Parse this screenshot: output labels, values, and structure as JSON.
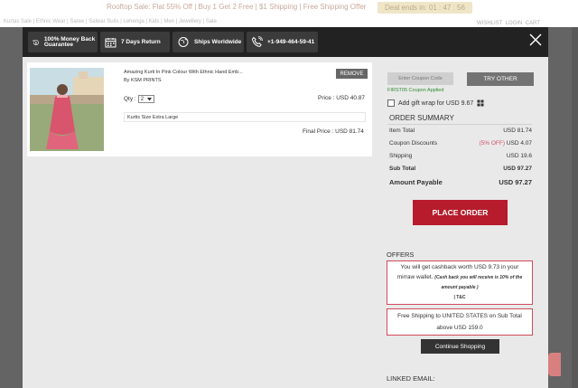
{
  "background": {
    "promo_text": "Rooftop Sale: Flat 55% Off | Buy 1 Get 2 Free | $1 Shipping | Free Shipping Offer",
    "deal_badge": "Deal ends in: 01 : 47 : 56",
    "nav_text": "Kurtas Sale | Ethnic Wear | Saree | Salwar Suits | Lehenga | Kids | Men | Jewellery | Sale",
    "wishlist": "WISHLIST",
    "login": "LOGIN",
    "cart": "CART"
  },
  "header": {
    "features": [
      {
        "icon": "money-back-icon",
        "label": "100% Money Back Guarantee"
      },
      {
        "icon": "calendar-icon",
        "label": "7 Days Return"
      },
      {
        "icon": "globe-icon",
        "label": "Ships Worldwide"
      },
      {
        "icon": "phone-icon",
        "label": "+1-949-464-59-41"
      }
    ]
  },
  "cart_item": {
    "name": "Amazing Kurti In Pink Colour With Ethnic Hand Emb...",
    "seller": "By KSM PRINTS",
    "remove_label": "REMOVE",
    "qty_label": "Qty :",
    "qty_value": "2",
    "price": "Price : USD 40.87",
    "size": "Kurtis Size Extra Large",
    "final_price": "Final Price : USD 81.74"
  },
  "coupon": {
    "placeholder": "Enter Coupon Code",
    "try_other": "TRY OTHER",
    "applied": "FIRST05 Coupon Applied"
  },
  "gift_wrap": {
    "label": "Add gift wrap for USD 9.67"
  },
  "order_summary": {
    "title": "ORDER SUMMARY",
    "item_total_label": "Item Total",
    "item_total": "USD 81.74",
    "coupon_label": "Coupon Discounts",
    "coupon_pct": "(5% OFF)",
    "coupon_value": "USD 4.07",
    "shipping_label": "Shipping",
    "shipping": "USD 19.6",
    "subtotal_label": "Sub Total",
    "subtotal": "USD 97.27",
    "payable_label": "Amount Payable",
    "payable": "USD 97.27",
    "place_order": "PLACE ORDER"
  },
  "offers": {
    "title": "OFFERS",
    "cashback_line1": "You will get cashback worth USD 9.73 in your",
    "cashback_line2": "mirraw wallet.",
    "cashback_note1": "(Cash back you will receive is 10% of the",
    "cashback_note2": "amount payable )",
    "tc": "| T&C",
    "free_ship_line1": "Free Shipping to UNITED STATES on Sub Total",
    "free_ship_line2": "above USD 159.0",
    "continue": "Continue Shopping"
  },
  "linked_email": {
    "title": "LINKED EMAIL:"
  }
}
